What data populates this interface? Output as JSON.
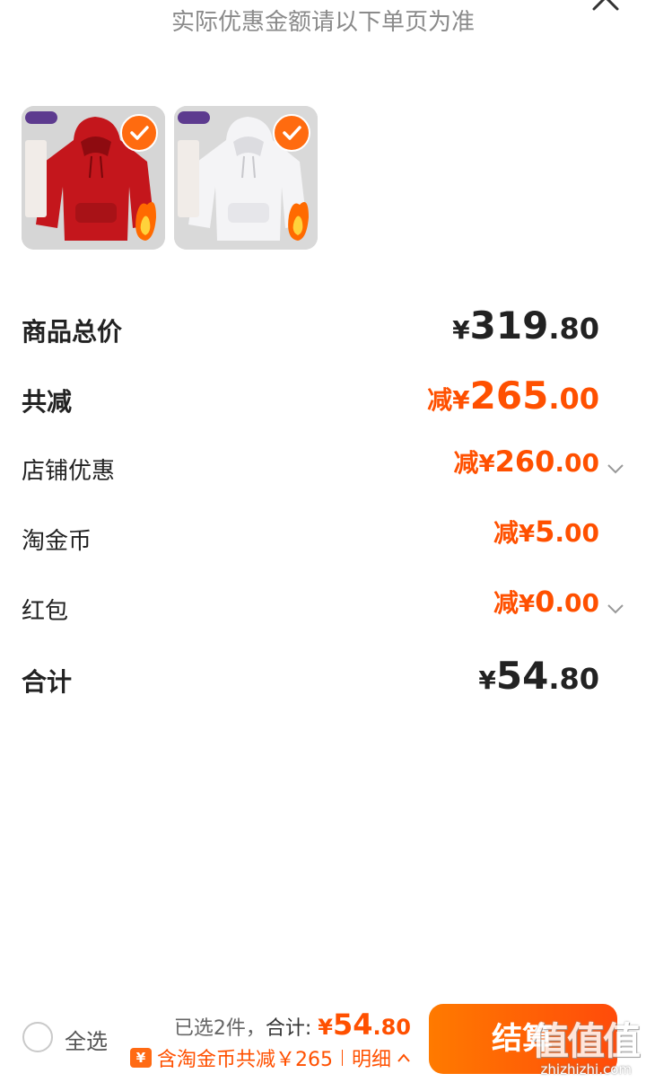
{
  "notice": "实际优惠金额请以下单页为准",
  "products": [
    {
      "color_name": "red-hoodie",
      "color": "#c4161c"
    },
    {
      "color_name": "white-hoodie",
      "color": "#f4f4f6"
    }
  ],
  "rows": {
    "total_price": {
      "label": "商品总价",
      "currency": "¥",
      "int": "319",
      "dec": ".80"
    },
    "total_discount": {
      "label": "共减",
      "prefix": "减",
      "currency": "¥",
      "int": "265",
      "dec": ".00"
    },
    "shop_discount": {
      "label": "店铺优惠",
      "prefix": "减",
      "currency": "¥",
      "int": "260",
      "dec": ".00"
    },
    "taojinbi": {
      "label": "淘金币",
      "prefix": "减",
      "currency": "¥",
      "int": "5",
      "dec": ".00"
    },
    "red_packet": {
      "label": "红包",
      "prefix": "减",
      "currency": "¥",
      "int": "0",
      "dec": ".00"
    },
    "grand_total": {
      "label": "合计",
      "currency": "¥",
      "int": "54",
      "dec": ".80"
    }
  },
  "bottom": {
    "select_all": "全选",
    "selected": "已选2件，",
    "total_label": "合计: ",
    "total_currency": "¥",
    "total_int": "54",
    "total_dec": ".80",
    "coin_badge": "¥",
    "coin_text": "含淘金币共减￥265",
    "detail": "明细",
    "checkout": "结算",
    "watermark": "值值值",
    "watermark_url": "zhizhizhi.com"
  },
  "colors": {
    "accent": "#ff5000",
    "button": "#ff6a00"
  }
}
